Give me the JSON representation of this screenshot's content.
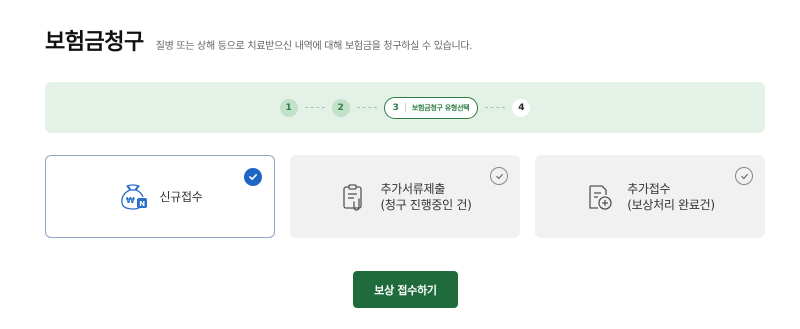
{
  "header": {
    "title": "보험금청구",
    "subtitle": "질병 또는 상해 등으로 치료받으신 내역에 대해 보험금을 청구하실 수 있습니다."
  },
  "stepper": {
    "steps": [
      {
        "number": "1",
        "state": "done"
      },
      {
        "number": "2",
        "state": "done"
      },
      {
        "number": "3",
        "state": "active",
        "label": "보험금청구 유형선택"
      },
      {
        "number": "4",
        "state": "upcoming"
      }
    ]
  },
  "options": [
    {
      "label": "신규접수",
      "label2": "",
      "icon": "money-bag-icon",
      "selected": true
    },
    {
      "label": "추가서류제출",
      "label2": "(청구 진행중인 건)",
      "icon": "clipboard-attach-icon",
      "selected": false
    },
    {
      "label": "추가접수",
      "label2": "(보상처리 완료건)",
      "icon": "document-add-icon",
      "selected": false
    }
  ],
  "submit_label": "보상 접수하기",
  "colors": {
    "accent_green": "#1f6b3c",
    "stepper_bg": "#e3f1e6",
    "selected_check": "#1f66c4"
  }
}
